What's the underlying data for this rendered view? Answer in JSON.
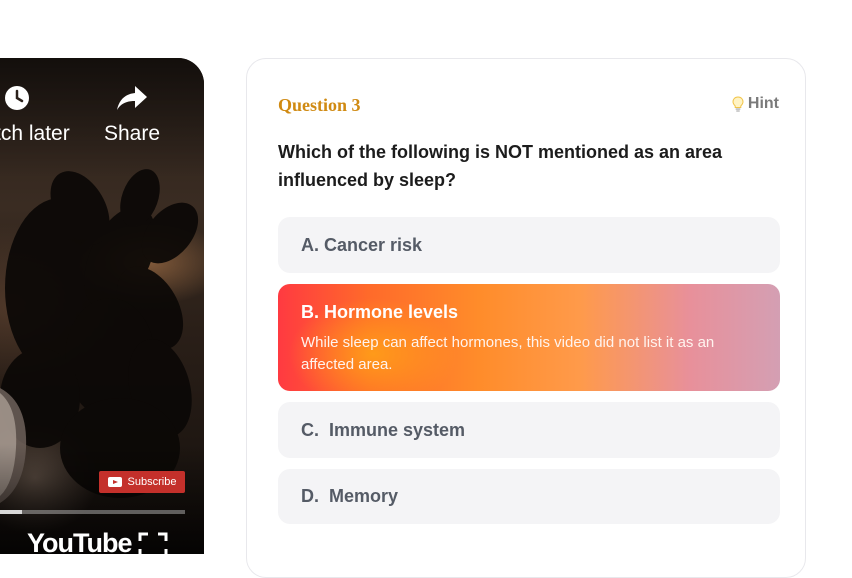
{
  "video": {
    "watch_later_label": "Watch later",
    "share_label": "Share",
    "subscribe_label": "Subscribe",
    "brand_label": "YouTube",
    "progress": 0.12
  },
  "quiz": {
    "question_label": "Question 3",
    "hint_label": "Hint",
    "question_text": "Which of the following is NOT mentioned as an area influenced by sleep?",
    "options": [
      {
        "letter": "A.",
        "text": "A. Cancer risk"
      },
      {
        "letter": "B.",
        "text": "B. Hormone levels",
        "feedback": "While sleep can affect hormones, this video did not list it as an affected area."
      },
      {
        "letter": "C.",
        "text": "C.  Immune system"
      },
      {
        "letter": "D.",
        "text": "D.  Memory"
      }
    ],
    "colors": {
      "accent": "#d08a12",
      "selected_start": "#ff3a41",
      "selected_end": "#d49fb3",
      "option_bg": "#f4f4f6"
    }
  }
}
